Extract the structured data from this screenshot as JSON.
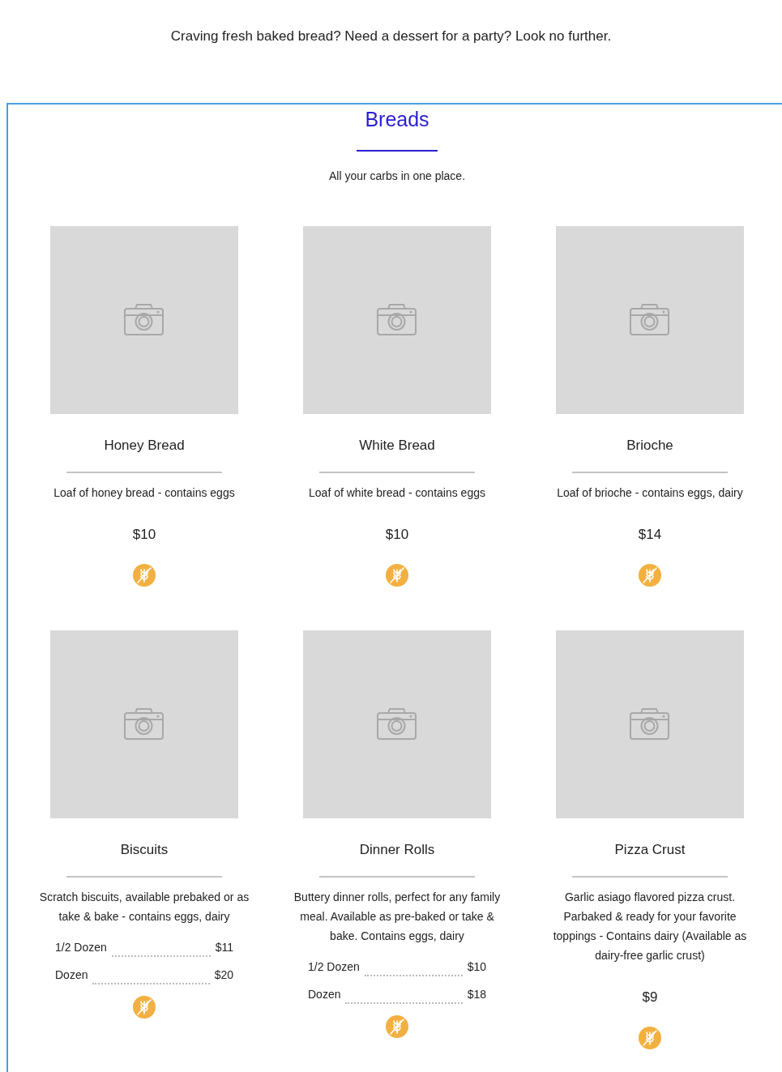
{
  "intro": "Craving fresh baked bread? Need a dessert for a party? Look no further.",
  "section": {
    "title": "Breads",
    "tagline": "All your carbs in one place.",
    "items": [
      {
        "kind": "single",
        "name": "Honey Bread",
        "description": "Loaf of honey bread - contains eggs",
        "price": "$10",
        "gluten_free_badge": true
      },
      {
        "kind": "single",
        "name": "White Bread",
        "description": "Loaf of white bread - contains eggs",
        "price": "$10",
        "gluten_free_badge": true
      },
      {
        "kind": "single",
        "name": "Brioche",
        "description": "Loaf of brioche - contains eggs, dairy",
        "price": "$14",
        "gluten_free_badge": true
      },
      {
        "kind": "options",
        "name": "Biscuits",
        "description": "Scratch biscuits, available prebaked or as take & bake - contains eggs, dairy",
        "options": [
          {
            "label": "1/2 Dozen",
            "price": "$11"
          },
          {
            "label": "Dozen",
            "price": "$20"
          }
        ],
        "gluten_free_badge": true
      },
      {
        "kind": "options",
        "name": "Dinner Rolls",
        "description": "Buttery dinner rolls, perfect for any family meal. Available as pre-baked or take & bake. Contains eggs, dairy",
        "options": [
          {
            "label": "1/2 Dozen",
            "price": "$10"
          },
          {
            "label": "Dozen",
            "price": "$18"
          }
        ],
        "gluten_free_badge": true
      },
      {
        "kind": "single",
        "name": "Pizza Crust",
        "description": "Garlic asiago flavored pizza crust. Parbaked & ready for your favorite toppings - Contains dairy (Available as dairy-free garlic crust)",
        "price": "$9",
        "gluten_free_badge": true
      }
    ]
  }
}
